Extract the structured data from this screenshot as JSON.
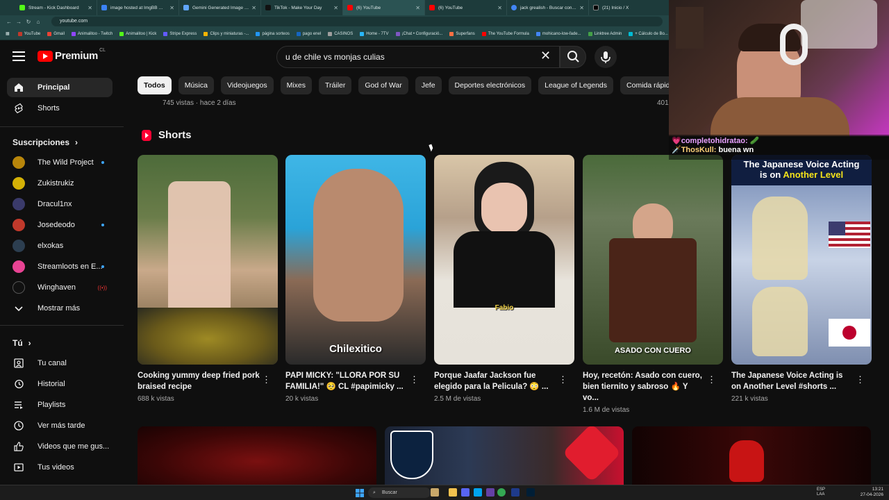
{
  "browser": {
    "tabs": [
      {
        "label": "Stream - Kick Dashboard",
        "color": "#53fc18"
      },
      {
        "label": "image hosted at ImgBB — Img...",
        "color": "#3b82f6"
      },
      {
        "label": "Gemini Generated Image pwzn...",
        "color": "#60a5fa"
      },
      {
        "label": "TikTok - Make Your Day",
        "color": "#111111"
      },
      {
        "label": "(6) YouTube",
        "color": "#ff0000"
      },
      {
        "label": "(6) YouTube",
        "color": "#ff0000"
      },
      {
        "label": "jack grealish - Buscar con Goog...",
        "color": "#4285f4"
      },
      {
        "label": "(21) Inicio / X",
        "color": "#000000"
      }
    ],
    "url": "youtube.com",
    "bookmarks": [
      "YouTube",
      "Gmail",
      "Animalitoo - Twitch",
      "Animalitoo | Kick",
      "Stripe Express",
      "Clips y miniaturas -...",
      "página sorteos",
      "pago enel",
      "CASINOS",
      "Home - 7TV",
      "¡Chat • Configuració...",
      "Superfans",
      "The YouTube Formula",
      "mohicano-low-fade...",
      "Linktree Admin",
      "+ Cálculo de Bo..."
    ]
  },
  "header": {
    "logo_word": "Premium",
    "country": "CL",
    "search_value": "u de chile vs monjas culias",
    "icons": [
      "menu-icon",
      "youtube-logo",
      "clear-icon",
      "search-icon",
      "mic-icon"
    ]
  },
  "sidebar": {
    "main": [
      {
        "label": "Principal",
        "icon": "home-icon"
      },
      {
        "label": "Shorts",
        "icon": "shorts-icon"
      }
    ],
    "subs_title": "Suscripciones",
    "subscriptions": [
      {
        "label": "The Wild Project",
        "color": "#b8860b",
        "dot": true
      },
      {
        "label": "Zukistrukiz",
        "color": "#d4b106",
        "dot": false
      },
      {
        "label": "Dracul1nx",
        "color": "#3a3a6a",
        "dot": false
      },
      {
        "label": "Josedeodo",
        "color": "#c0392b",
        "dot": true
      },
      {
        "label": "elxokas",
        "color": "#2c3e50",
        "dot": false
      },
      {
        "label": "Streamloots en E...",
        "color": "#e84393",
        "dot": true
      },
      {
        "label": "Winghaven",
        "color": "#111111",
        "live": "((•))"
      }
    ],
    "show_more": "Mostrar más",
    "you_title": "Tú",
    "you": [
      {
        "label": "Tu canal",
        "icon": "channel-icon"
      },
      {
        "label": "Historial",
        "icon": "history-icon"
      },
      {
        "label": "Playlists",
        "icon": "playlists-icon"
      },
      {
        "label": "Ver más tarde",
        "icon": "clock-icon"
      },
      {
        "label": "Videos que me gus...",
        "icon": "like-icon"
      },
      {
        "label": "Tus videos",
        "icon": "video-icon"
      }
    ]
  },
  "chips": [
    "Todos",
    "Música",
    "Videojuegos",
    "Mixes",
    "Tráiler",
    "God of War",
    "Jefe",
    "Deportes electrónicos",
    "League of Legends",
    "Comida rápida"
  ],
  "main": {
    "prev_meta": "745 vistas · hace 2 días",
    "prev_meta2": "401",
    "shorts_title": "Shorts",
    "shorts": [
      {
        "title": "Cooking yummy deep fried pork braised recipe",
        "views": "688 k vistas",
        "overlay": "",
        "bg": "linear-gradient(180deg,#4d6b3a 0%,#6b7d4a 30%,#c9a98a 55%,#5a4a2a 100%)"
      },
      {
        "title": "PAPI MICKY: \"LLORA POR SU FAMILIA!\" 🥺 CL #papimicky ...",
        "views": "20 k vistas",
        "overlay": "Chilexitico",
        "bg": "linear-gradient(180deg,#3fb6e6 0%,#2aa3d8 35%,#8a6a55 60%,#2a2a2a 100%)"
      },
      {
        "title": "Porque Jaafar Jackson fue elegido para la Pelicula? 😳 ...",
        "views": "2.5 M de vistas",
        "overlay": "Fabio",
        "bg": "linear-gradient(180deg,#d9c6a8 0%,#8a6a55 30%,#111 55%,#e8e4dc 100%)"
      },
      {
        "title": "Hoy, recetón: Asado con cuero, bien tiernito y sabroso 🔥 Y vo...",
        "views": "1.6 M de vistas",
        "overlay": "ASADO CON CUERO",
        "bg": "linear-gradient(180deg,#4a6a3a 0%,#6a7a5a 30%,#4a2a1a 60%,#3a4a2a 100%)"
      },
      {
        "title": "The Japanese Voice Acting is on Another Level #shorts ...",
        "views": "221 k vistas",
        "overlay": "",
        "bg": "linear-gradient(180deg,#1c2b52 0%,#6f86b2 35%,#c8d3e6 60%,#7f8fb0 100%)"
      }
    ],
    "shorts_banner": [
      "The Japanese Voice Acting",
      "is on",
      "Another Level"
    ]
  },
  "stream_chat": [
    {
      "user": "completohidratao:",
      "msg": "🥒"
    },
    {
      "user": "ThosKull:",
      "msg": "buena wn"
    }
  ],
  "taskbar": {
    "search": "Buscar",
    "lang1": "ESP",
    "lang2": "LAA",
    "time": "13:21",
    "date": "27-04-2026"
  }
}
